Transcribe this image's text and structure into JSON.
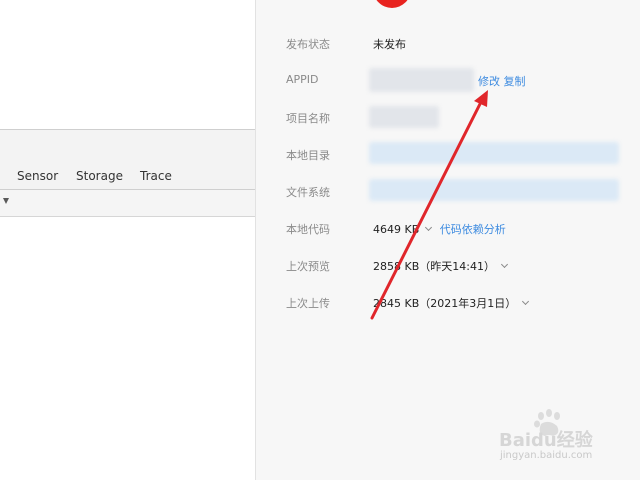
{
  "devtools": {
    "tabs": [
      "Sensor",
      "Storage",
      "Trace"
    ]
  },
  "details": {
    "publish_status": {
      "label": "发布状态",
      "value": "未发布"
    },
    "appid": {
      "label": "APPID",
      "edit_link": "修改",
      "copy_link": "复制"
    },
    "project_name": {
      "label": "项目名称"
    },
    "local_dir": {
      "label": "本地目录"
    },
    "file_system": {
      "label": "文件系统"
    },
    "local_code": {
      "label": "本地代码",
      "size": "4649 KB",
      "link": "代码依赖分析"
    },
    "last_preview": {
      "label": "上次预览",
      "value": "2858 KB（昨天14:41）"
    },
    "last_upload": {
      "label": "上次上传",
      "value": "2845 KB（2021年3月1日）"
    }
  },
  "watermark": {
    "brand": "Baidu经验",
    "url": "jingyan.baidu.com"
  },
  "colors": {
    "accent_link": "#3d8be0",
    "annotation_arrow": "#e0262b",
    "panel_bg": "#f7f7f7"
  }
}
